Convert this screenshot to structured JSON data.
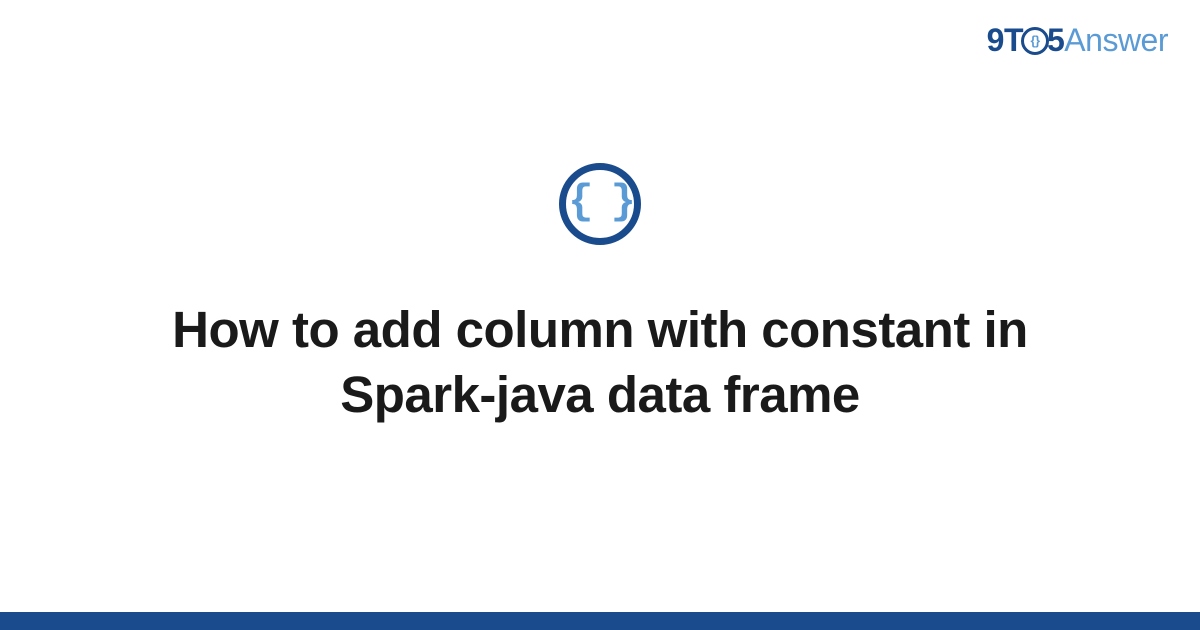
{
  "logo": {
    "part1": "9T",
    "o_inner": "{}",
    "part2": "5",
    "part3": "Answer"
  },
  "icon": {
    "glyph": "{ }"
  },
  "title": "How to add column with constant in Spark-java data frame",
  "colors": {
    "brand_primary": "#1a4b8c",
    "brand_secondary": "#5b9bd5"
  }
}
